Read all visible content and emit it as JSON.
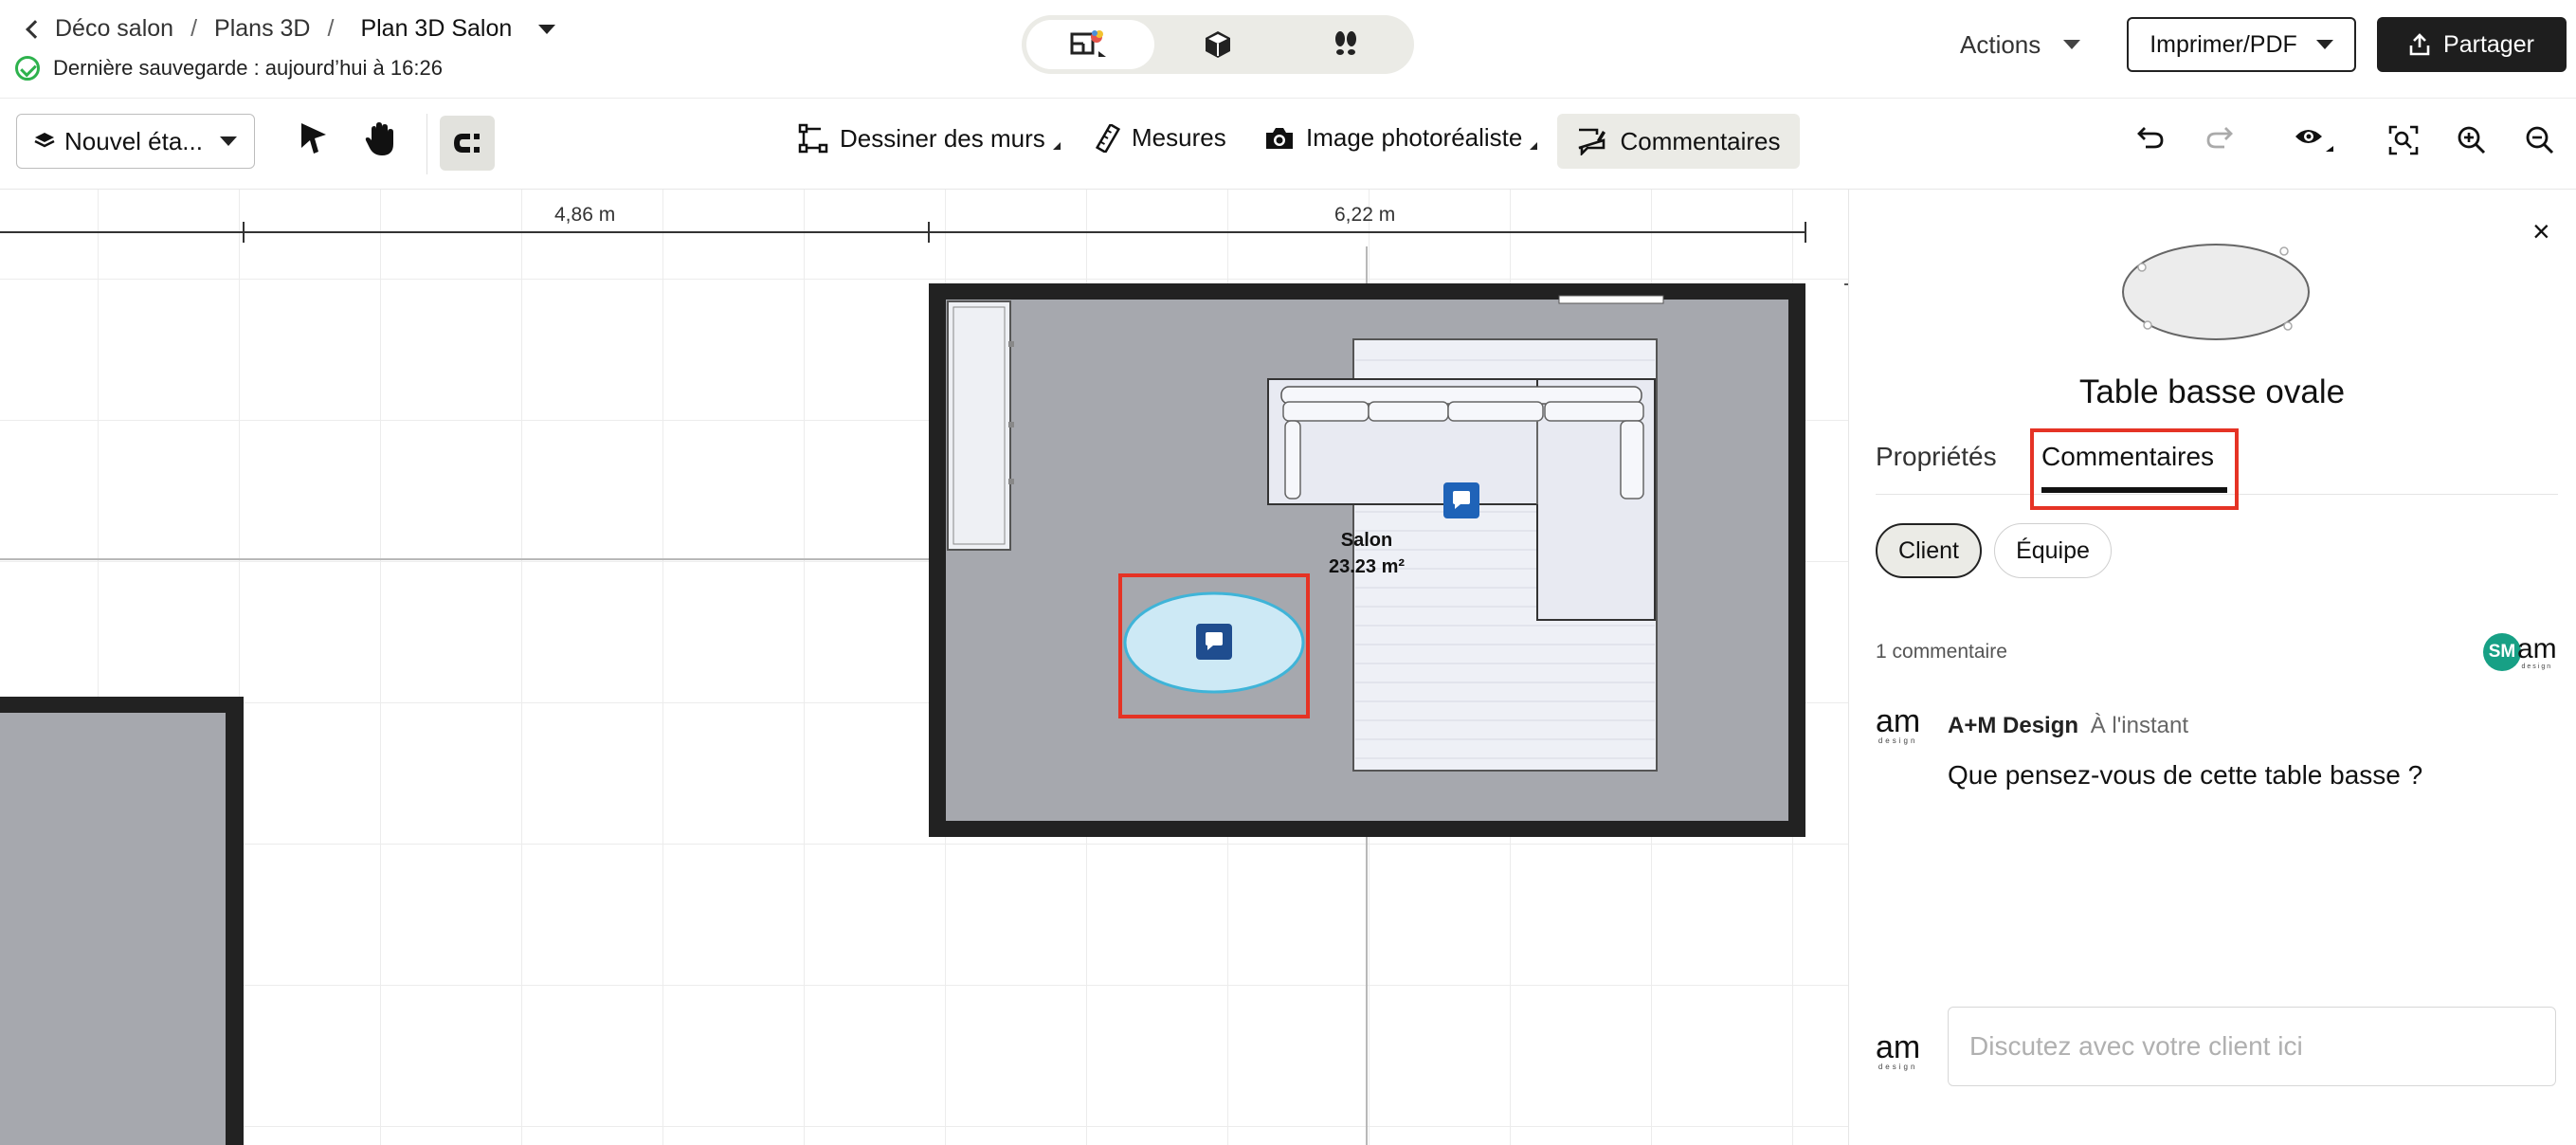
{
  "header": {
    "breadcrumb": [
      "Déco salon",
      "Plans 3D"
    ],
    "breadcrumb_separator": "/",
    "project_name": "Plan 3D Salon",
    "save_status": "Dernière sauvegarde : aujourd’hui à 16:26",
    "actions_label": "Actions",
    "print_label": "Imprimer/PDF",
    "share_label": "Partager"
  },
  "toolbar": {
    "floor_label": "Nouvel éta...",
    "draw_walls_label": "Dessiner des murs",
    "measures_label": "Mesures",
    "photo_label": "Image photoréaliste",
    "comments_label": "Commentaires"
  },
  "canvas": {
    "dimension_1": "4,86 m",
    "dimension_2": "6,22 m",
    "room_name": "Salon",
    "room_area": "23.23 m²"
  },
  "panel": {
    "close_symbol": "×",
    "object_title": "Table basse ovale",
    "tabs": [
      {
        "label": "Propriétés",
        "active": false
      },
      {
        "label": "Commentaires",
        "active": true
      }
    ],
    "filters": [
      {
        "label": "Client",
        "active": true
      },
      {
        "label": "Équipe",
        "active": false
      }
    ],
    "comment_count": "1 commentaire",
    "avatar_initials": "SM",
    "logo_text": "am",
    "logo_subtext": "design",
    "comments": [
      {
        "author": "A+M Design",
        "time": "À l'instant",
        "text": "Que pensez-vous de cette table basse ?"
      }
    ],
    "input_placeholder": "Discutez avec votre client ici"
  },
  "colors": {
    "accent_highlight": "#e53325",
    "comment_marker": "#1f63b8",
    "floor": "#a6a8ae",
    "wall": "#222222",
    "selected_object": "#cde9f5",
    "avatar": "#17a085"
  }
}
